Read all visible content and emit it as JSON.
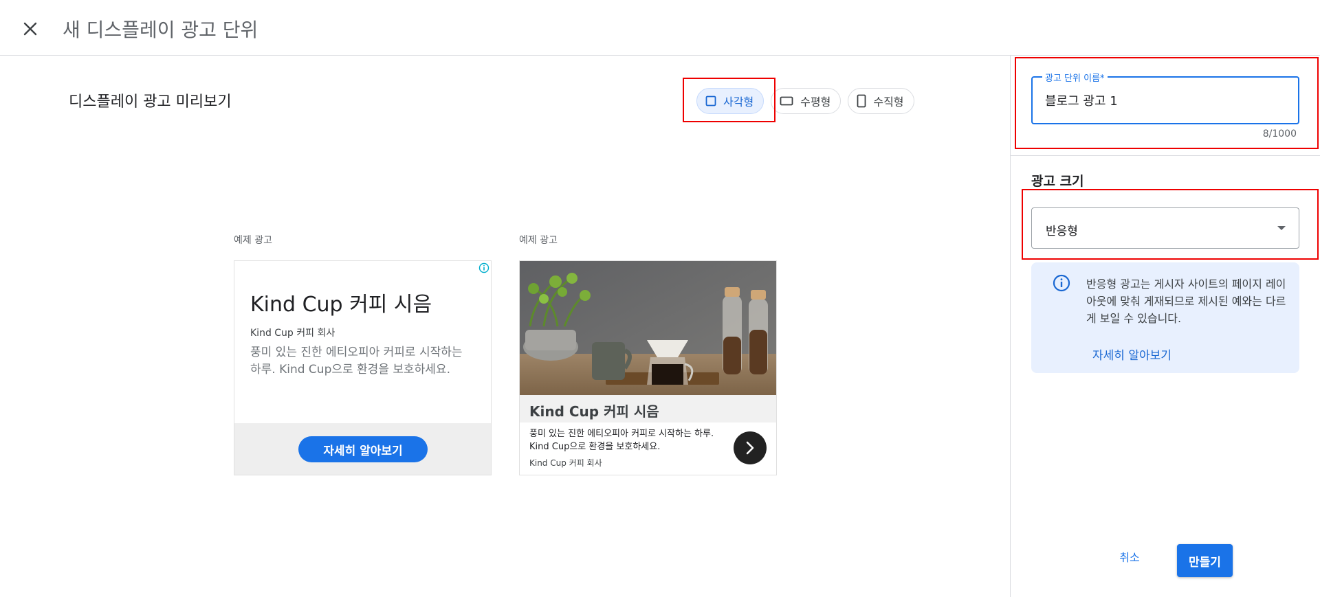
{
  "header": {
    "title": "새 디스플레이 광고 단위",
    "close_icon": "close-icon"
  },
  "preview": {
    "title": "디스플레이 광고 미리보기",
    "shapes": [
      {
        "label": "사각형",
        "icon": "square-icon",
        "selected": true
      },
      {
        "label": "수평형",
        "icon": "horizontal-rect-icon",
        "selected": false
      },
      {
        "label": "수직형",
        "icon": "vertical-rect-icon",
        "selected": false
      }
    ],
    "ad_label": "예제 광고",
    "ad1": {
      "headline": "Kind Cup 커피 시음",
      "company": "Kind Cup 커피 회사",
      "description": "풍미 있는 진한 에티오피아 커피로 시작하는 하루. Kind Cup으로 환경을 보호하세요.",
      "cta": "자세히 알아보기"
    },
    "ad2": {
      "headline": "Kind Cup 커피 시음",
      "description": "풍미 있는 진한 에티오피아 커피로 시작하는 하루. Kind Cup으로 환경을 보호하세요.",
      "company": "Kind Cup 커피 회사"
    }
  },
  "sidebar": {
    "name_field": {
      "label": "광고 단위 이름*",
      "value": "블로그 광고 1",
      "counter": "8/1000"
    },
    "size": {
      "label": "광고 크기",
      "value": "반응형"
    },
    "notice": {
      "text": "반응형 광고는 게시자 사이트의 페이지 레이아웃에 맞춰 게재되므로 제시된 예와는 다르게 보일 수 있습니다.",
      "link": "자세히 알아보기"
    },
    "actions": {
      "cancel": "취소",
      "create": "만들기"
    }
  },
  "colors": {
    "primary": "#1a73e8",
    "highlight": "#ee0000",
    "notice_bg": "#e8f0fe"
  }
}
